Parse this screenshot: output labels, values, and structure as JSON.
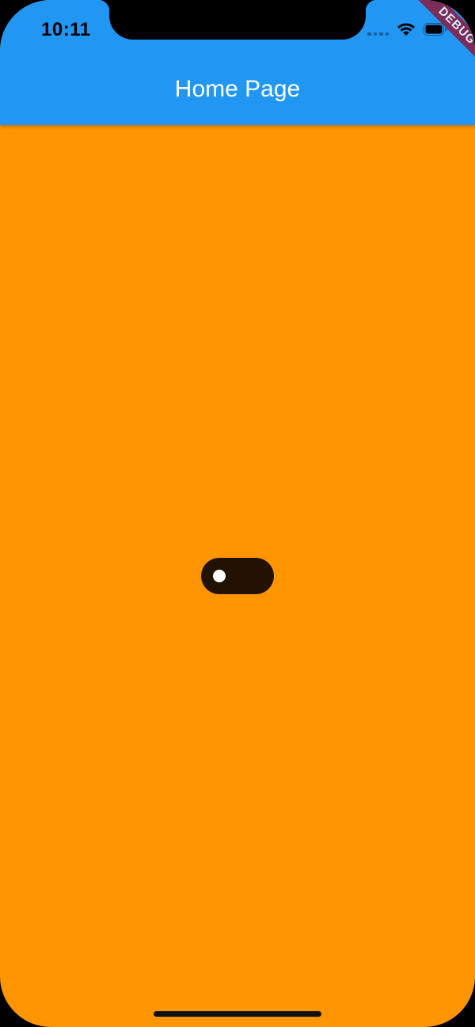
{
  "status_bar": {
    "time": "10:11",
    "wifi_icon": "wifi-icon",
    "battery_icon": "battery-icon"
  },
  "app_bar": {
    "title": "Home Page",
    "color": "#2196f3"
  },
  "debug_banner": {
    "label": "DEBUG"
  },
  "body": {
    "background_color": "#ff9500",
    "toggle": {
      "on": false
    }
  }
}
